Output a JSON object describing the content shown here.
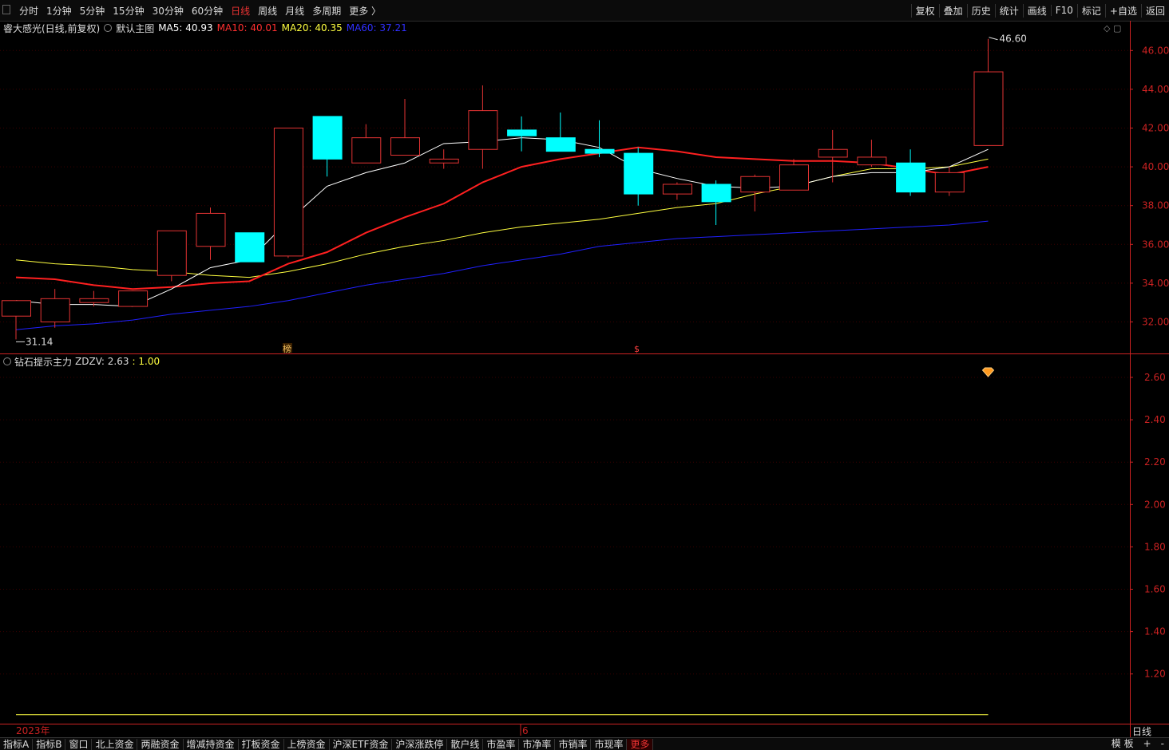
{
  "toolbar": {
    "periods": [
      "分时",
      "1分钟",
      "5分钟",
      "15分钟",
      "30分钟",
      "60分钟",
      "日线",
      "周线",
      "月线",
      "多周期",
      "更多 〉"
    ],
    "active_period": "日线",
    "right_tools": [
      "复权",
      "叠加",
      "历史",
      "统计",
      "画线",
      "F10",
      "标记",
      "+自选",
      "返回"
    ]
  },
  "main_chart": {
    "title": "睿大感光(日线,前复权)",
    "template": "默认主图",
    "ma5_label": "MA5: 40.93",
    "ma10_label": "MA10: 40.01",
    "ma20_label": "MA20: 40.35",
    "ma60_label": "MA60: 37.21",
    "high_label": "46.60",
    "low_label": "31.14",
    "markers": [
      "榜",
      "$"
    ]
  },
  "sub_chart": {
    "title": "钻石提示主力",
    "zdzv_label": "ZDZV: 2.63",
    "value2_label": ": 1.00"
  },
  "x_axis": {
    "year_label": "2023年",
    "month_label": "6"
  },
  "period_label": "日线",
  "bottom_tabs": [
    "指标A",
    "指标B",
    "窗口",
    "北上资金",
    "两融资金",
    "增减持资金",
    "打板资金",
    "上榜资金",
    "沪深ETF资金",
    "沪深涨跌停",
    "散户线",
    "市盈率",
    "市净率",
    "市销率",
    "市现率",
    "更多"
  ],
  "bottom_right": [
    "模 板",
    "+",
    "-"
  ],
  "colors": {
    "up": "#e33333",
    "down": "#00ffff",
    "ma5": "#ffffff",
    "ma10": "#ff2020",
    "ma20": "#ffff40",
    "ma60": "#2020ff",
    "axis": "#cc2222"
  },
  "chart_data": {
    "type": "candlestick",
    "price_axis": [
      46.0,
      44.0,
      42.0,
      40.0,
      38.0,
      36.0,
      34.0,
      32.0
    ],
    "candles": [
      {
        "o": 32.3,
        "h": 32.3,
        "l": 31.1,
        "c": 33.1
      },
      {
        "o": 32.0,
        "h": 33.7,
        "l": 31.7,
        "c": 33.2
      },
      {
        "o": 33.0,
        "h": 33.6,
        "l": 32.8,
        "c": 33.2
      },
      {
        "o": 32.8,
        "h": 33.6,
        "l": 32.8,
        "c": 33.6
      },
      {
        "o": 34.4,
        "h": 36.5,
        "l": 34.1,
        "c": 36.7
      },
      {
        "o": 35.9,
        "h": 37.9,
        "l": 35.2,
        "c": 37.6
      },
      {
        "o": 36.6,
        "h": 36.6,
        "l": 35.1,
        "c": 35.1
      },
      {
        "o": 35.4,
        "h": 42.0,
        "l": 35.3,
        "c": 42.0
      },
      {
        "o": 42.6,
        "h": 42.6,
        "l": 39.5,
        "c": 40.4
      },
      {
        "o": 40.2,
        "h": 42.2,
        "l": 40.2,
        "c": 41.5
      },
      {
        "o": 40.6,
        "h": 43.5,
        "l": 40.6,
        "c": 41.5
      },
      {
        "o": 40.2,
        "h": 40.9,
        "l": 39.9,
        "c": 40.4
      },
      {
        "o": 40.9,
        "h": 44.2,
        "l": 39.9,
        "c": 42.9
      },
      {
        "o": 41.9,
        "h": 42.6,
        "l": 40.8,
        "c": 41.6
      },
      {
        "o": 41.5,
        "h": 42.8,
        "l": 41.5,
        "c": 40.8
      },
      {
        "o": 40.9,
        "h": 42.4,
        "l": 40.5,
        "c": 40.7
      },
      {
        "o": 40.7,
        "h": 41.0,
        "l": 38.0,
        "c": 38.6
      },
      {
        "o": 38.6,
        "h": 39.2,
        "l": 38.3,
        "c": 39.1
      },
      {
        "o": 39.1,
        "h": 39.3,
        "l": 37.0,
        "c": 38.2
      },
      {
        "o": 38.7,
        "h": 39.6,
        "l": 37.7,
        "c": 39.5
      },
      {
        "o": 38.8,
        "h": 40.4,
        "l": 38.8,
        "c": 40.1
      },
      {
        "o": 40.5,
        "h": 41.9,
        "l": 39.2,
        "c": 40.9
      },
      {
        "o": 40.1,
        "h": 41.4,
        "l": 40.0,
        "c": 40.5
      },
      {
        "o": 40.2,
        "h": 40.9,
        "l": 38.5,
        "c": 38.7
      },
      {
        "o": 38.7,
        "h": 40.0,
        "l": 38.5,
        "c": 39.7
      },
      {
        "o": 41.1,
        "h": 46.6,
        "l": 42.3,
        "c": 44.9
      }
    ],
    "ma5": [
      33.1,
      32.9,
      32.9,
      32.8,
      33.7,
      34.8,
      35.2,
      37.2,
      39.0,
      39.7,
      40.2,
      41.2,
      41.3,
      41.5,
      41.4,
      41.0,
      39.9,
      39.4,
      39.0,
      38.9,
      39.0,
      39.5,
      39.7,
      39.7,
      40.0,
      40.9
    ],
    "ma10": [
      34.3,
      34.2,
      33.9,
      33.7,
      33.8,
      34.0,
      34.1,
      35.0,
      35.6,
      36.6,
      37.4,
      38.1,
      39.2,
      40.0,
      40.4,
      40.7,
      41.0,
      40.8,
      40.5,
      40.4,
      40.3,
      40.3,
      40.2,
      39.9,
      39.6,
      40.0
    ],
    "ma20": [
      35.2,
      35.0,
      34.9,
      34.7,
      34.6,
      34.4,
      34.3,
      34.6,
      35.0,
      35.5,
      35.9,
      36.2,
      36.6,
      36.9,
      37.1,
      37.3,
      37.6,
      37.9,
      38.1,
      38.6,
      39.0,
      39.5,
      39.9,
      39.9,
      40.0,
      40.4
    ],
    "ma60": [
      31.6,
      31.8,
      31.9,
      32.1,
      32.4,
      32.6,
      32.8,
      33.1,
      33.5,
      33.9,
      34.2,
      34.5,
      34.9,
      35.2,
      35.5,
      35.9,
      36.1,
      36.3,
      36.4,
      36.5,
      36.6,
      36.7,
      36.8,
      36.9,
      37.0,
      37.2
    ],
    "sub_axis": [
      2.6,
      2.4,
      2.2,
      2.0,
      1.8,
      1.6,
      1.4,
      1.2
    ],
    "sub_line_value": 1.0,
    "diamond_value": 2.63
  }
}
